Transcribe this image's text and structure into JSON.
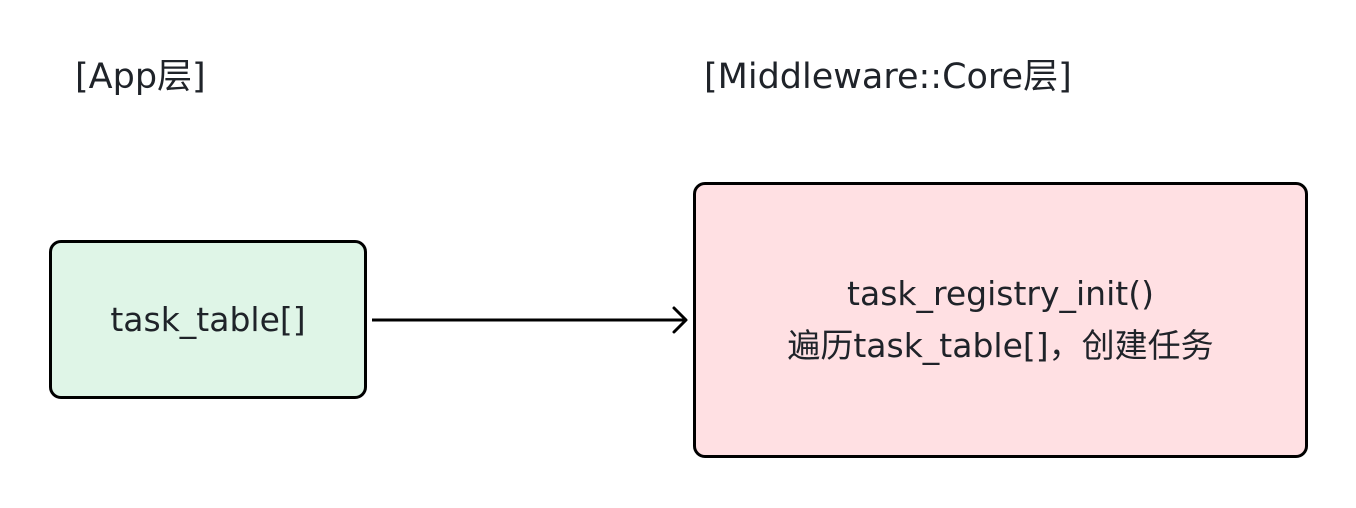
{
  "layers": {
    "app_label": "[App层]",
    "core_label": "[Middleware::Core层]"
  },
  "app_box": {
    "text": "task_table[]",
    "fill": "#dff5e7"
  },
  "core_box": {
    "line1": "task_registry_init()",
    "line2": "遍历task_table[]，创建任务",
    "fill": "#ffe0e3"
  },
  "colors": {
    "border": "#000000",
    "text": "#1f2329",
    "arrow": "#000000"
  }
}
